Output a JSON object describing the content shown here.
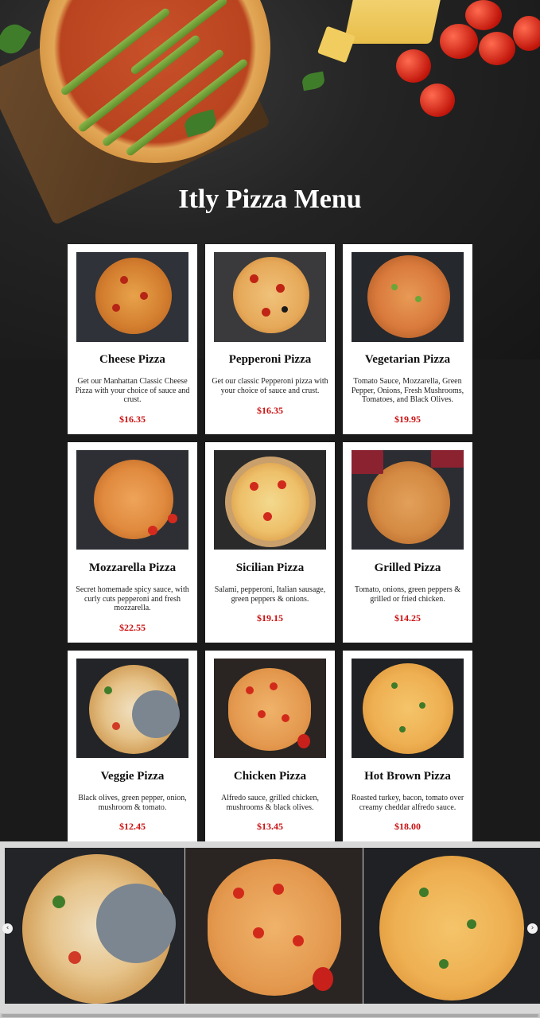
{
  "header": {
    "title": "Itly Pizza Menu"
  },
  "menu": [
    {
      "name": "Cheese Pizza",
      "description": "Get our Manhattan Classic Cheese Pizza with your choice of sauce and crust.",
      "price": "$16.35"
    },
    {
      "name": "Pepperoni Pizza",
      "description": "Get our classic Pepperoni pizza with your choice of sauce and crust.",
      "price": "$16.35"
    },
    {
      "name": "Vegetarian Pizza",
      "description": "Tomato Sauce, Mozzarella, Green Pepper, Onions, Fresh Mushrooms, Tomatoes, and Black Olives.",
      "price": "$19.95"
    },
    {
      "name": "Mozzarella Pizza",
      "description": "Secret homemade spicy sauce, with curly cuts pepperoni and fresh mozzarella.",
      "price": "$22.55"
    },
    {
      "name": "Sicilian Pizza",
      "description": "Salami, pepperoni, Italian sausage, green peppers & onions.",
      "price": "$19.15"
    },
    {
      "name": "Grilled Pizza",
      "description": "Tomato, onions, green peppers & grilled or fried chicken.",
      "price": "$14.25"
    },
    {
      "name": "Veggie Pizza",
      "description": "Black olives, green pepper, onion, mushroom & tomato.",
      "price": "$12.45"
    },
    {
      "name": "Chicken Pizza",
      "description": "Alfredo sauce, grilled chicken, mushrooms & black olives.",
      "price": "$13.45"
    },
    {
      "name": "Hot Brown Pizza",
      "description": "Roasted turkey, bacon, tomato over creamy cheddar alfredo sauce.",
      "price": "$18.00"
    }
  ],
  "slider": {
    "prev_icon": "chevron-left-icon",
    "next_icon": "chevron-right-icon",
    "prev_glyph": "‹",
    "next_glyph": "›"
  },
  "colors": {
    "price": "#cc1010",
    "background": "#1a1a1a",
    "card": "#ffffff"
  }
}
